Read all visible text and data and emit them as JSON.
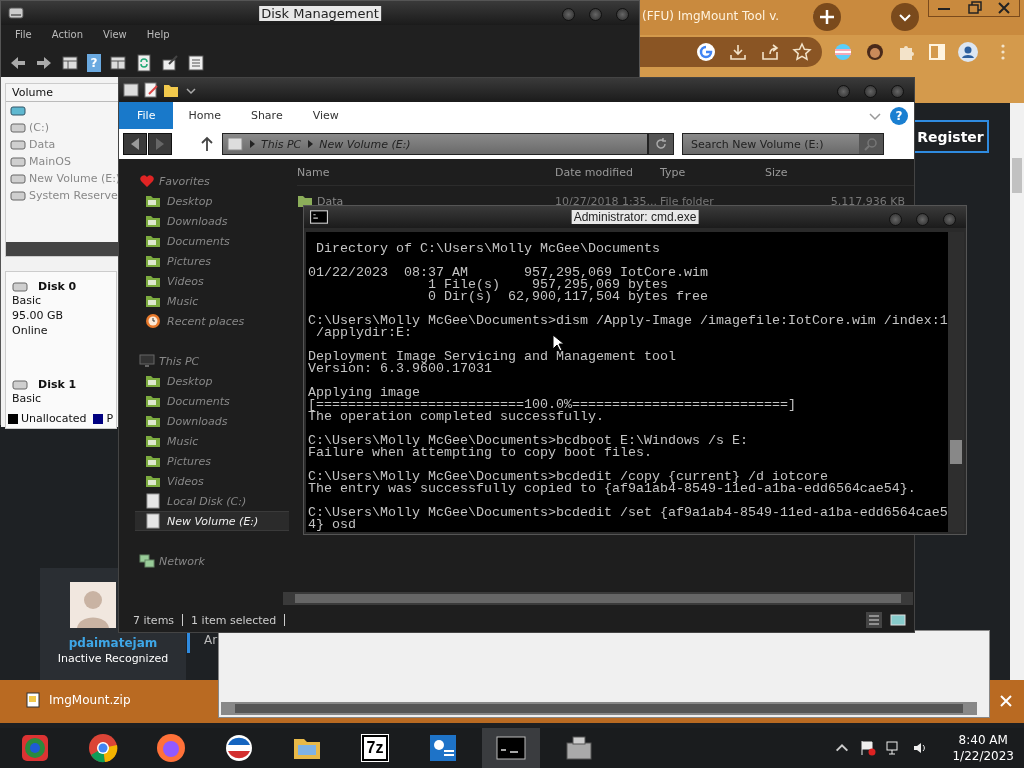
{
  "help_icons": [
    "?",
    "?"
  ],
  "browser": {
    "tab_title": "(FFU) ImgMount Tool v.",
    "register_button": "Register",
    "side_tab": "Ar",
    "profile": {
      "username": "pdaimatejam",
      "status": "Inactive Recognized"
    },
    "download": {
      "file": "ImgMount.zip"
    }
  },
  "disk_management": {
    "title": "Disk Management",
    "menu": [
      "File",
      "Action",
      "View",
      "Help"
    ],
    "volume_header": "Volume",
    "volumes": [
      "(C:)",
      "Data",
      "MainOS",
      "New Volume (E:)",
      "System Reserve"
    ],
    "disks": [
      {
        "name": "Disk 0",
        "lines": [
          "Basic",
          "95.00 GB",
          "Online"
        ]
      },
      {
        "name": "Disk 1",
        "lines": [
          "Basic"
        ]
      }
    ],
    "legend": [
      {
        "label": "Unallocated",
        "color": "#000000"
      },
      {
        "label": "P",
        "color": "#000080"
      }
    ]
  },
  "explorer": {
    "ribbon_tabs": [
      {
        "label": "File",
        "selected": true
      },
      {
        "label": "Home",
        "selected": false
      },
      {
        "label": "Share",
        "selected": false
      },
      {
        "label": "View",
        "selected": false
      }
    ],
    "breadcrumb": [
      "This PC",
      "New Volume (E:)"
    ],
    "search": {
      "placeholder": "Search New Volume (E:)"
    },
    "nav": [
      {
        "label": "Favorites",
        "kind": "favorites",
        "children": [
          {
            "label": "Desktop",
            "kind": "folder",
            "selected": false
          },
          {
            "label": "Downloads",
            "kind": "folder",
            "selected": false
          },
          {
            "label": "Documents",
            "kind": "folder",
            "selected": false
          },
          {
            "label": "Pictures",
            "kind": "folder",
            "selected": false
          },
          {
            "label": "Videos",
            "kind": "folder",
            "selected": false
          },
          {
            "label": "Music",
            "kind": "folder",
            "selected": false
          },
          {
            "label": "Recent places",
            "kind": "recent",
            "selected": false
          }
        ]
      },
      {
        "label": "This PC",
        "kind": "computer",
        "children": [
          {
            "label": "Desktop",
            "kind": "folder",
            "selected": false
          },
          {
            "label": "Documents",
            "kind": "folder",
            "selected": false
          },
          {
            "label": "Downloads",
            "kind": "folder",
            "selected": false
          },
          {
            "label": "Music",
            "kind": "folder",
            "selected": false
          },
          {
            "label": "Pictures",
            "kind": "folder",
            "selected": false
          },
          {
            "label": "Videos",
            "kind": "folder",
            "selected": false
          },
          {
            "label": "Local Disk (C:)",
            "kind": "drive",
            "selected": false
          },
          {
            "label": "New Volume (E:)",
            "kind": "drive",
            "selected": true
          }
        ]
      },
      {
        "label": "Network",
        "kind": "network"
      }
    ],
    "columns": [
      "Name",
      "Date modified",
      "Type",
      "Size"
    ],
    "rows": [
      {
        "name": "Data",
        "date": "10/27/2018 1:35...",
        "type": "File folder",
        "size": "5,117,936 KB"
      }
    ],
    "status": [
      "7 items",
      "1 item selected"
    ]
  },
  "cmd": {
    "title": "Administrator: cmd.exe",
    "blocks": [
      [
        " Directory of C:\\Users\\Molly McGee\\Documents"
      ],
      [
        "01/22/2023  08:37 AM       957,295,069 IotCore.wim",
        "               1 File(s)    957,295,069 bytes",
        "               0 Dir(s)  62,900,117,504 bytes free"
      ],
      [
        "C:\\Users\\Molly McGee\\Documents>dism /Apply-Image /imagefile:IotCore.wim /index:1",
        " /applydir:E:"
      ],
      [
        "Deployment Image Servicing and Management tool",
        "Version: 6.3.9600.17031"
      ],
      [
        "Applying image",
        "[==========================100.0%===========================]",
        "The operation completed successfully."
      ],
      [
        "C:\\Users\\Molly McGee\\Documents>bcdboot E:\\Windows /s E:",
        "Failure when attempting to copy boot files."
      ],
      [
        "C:\\Users\\Molly McGee\\Documents>bcdedit /copy {current} /d iotcore",
        "The entry was successfully copied to {af9a1ab4-8549-11ed-a1ba-edd6564cae54}."
      ],
      [
        "C:\\Users\\Molly McGee\\Documents>bcdedit /set {af9a1ab4-8549-11ed-a1ba-edd6564cae5",
        "4} osd"
      ]
    ]
  },
  "taskbar": {
    "apps": [
      {
        "kind": "chromium",
        "selected": false
      },
      {
        "kind": "chrome",
        "selected": false
      },
      {
        "kind": "firefox",
        "selected": false
      },
      {
        "kind": "globe",
        "selected": false
      },
      {
        "kind": "folder",
        "selected": false
      },
      {
        "kind": "archive",
        "label": "7z",
        "selected": false
      },
      {
        "kind": "settings",
        "selected": false
      },
      {
        "kind": "terminal",
        "selected": true
      },
      {
        "kind": "toolbox",
        "selected": false
      }
    ],
    "time": "8:40 AM",
    "date": "1/22/2023"
  }
}
